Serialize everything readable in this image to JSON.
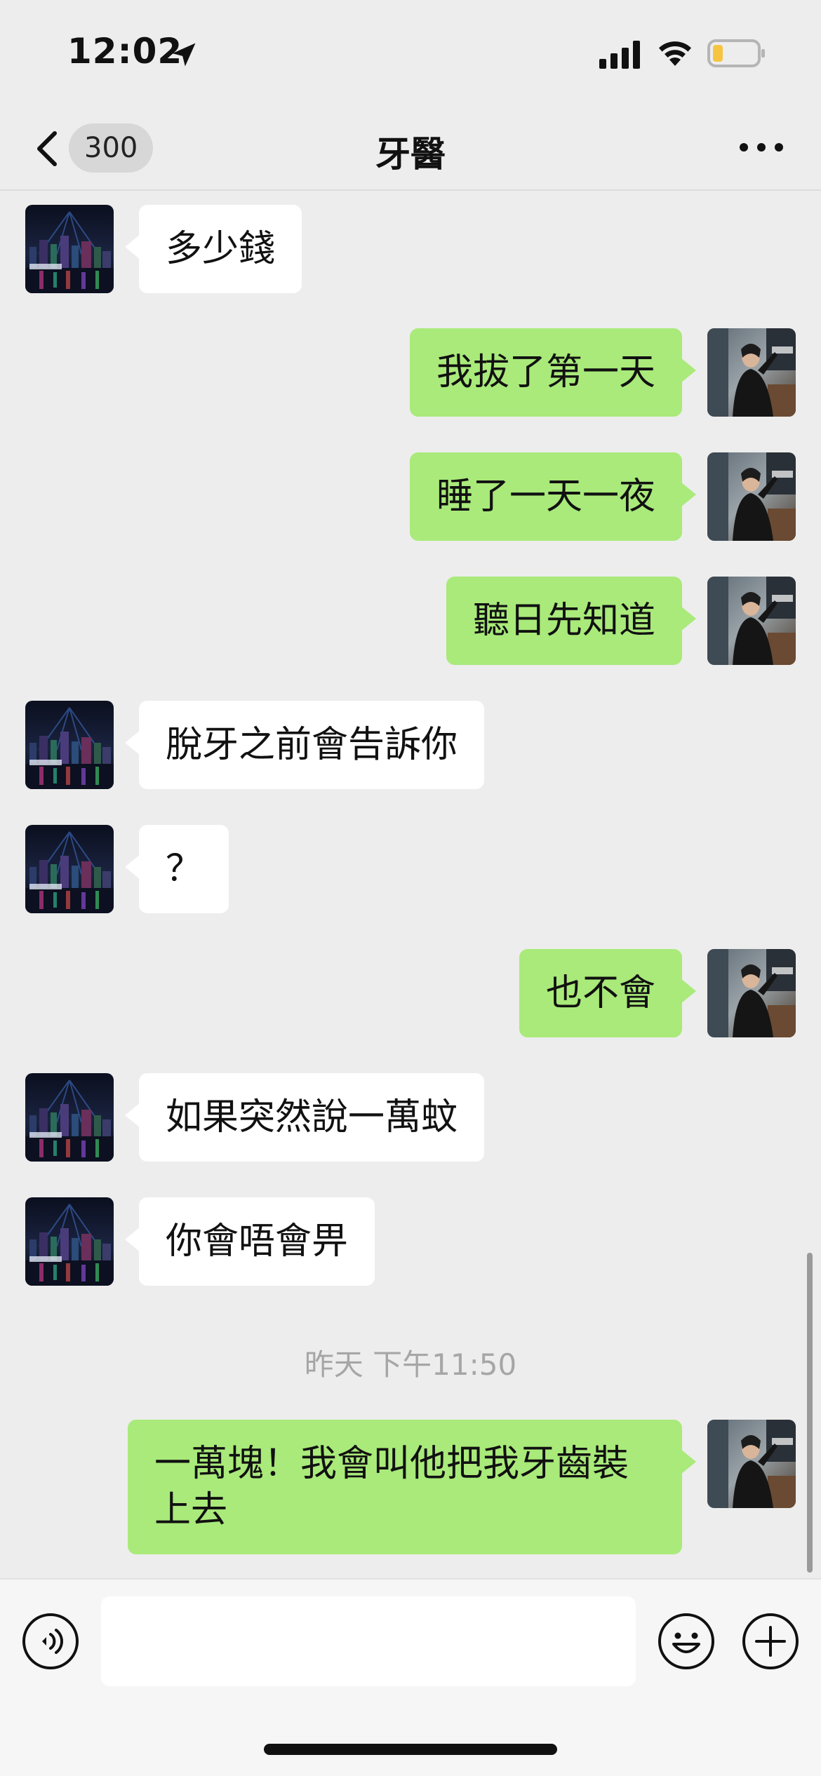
{
  "status_bar": {
    "time": "12:02",
    "icons": [
      "location-arrow-icon",
      "signal-icon",
      "wifi-icon",
      "battery-low-icon"
    ]
  },
  "nav": {
    "unread_count": "300",
    "title": "牙醫",
    "icons": [
      "chevron-left-icon",
      "more-icon"
    ]
  },
  "messages": [
    {
      "side": "incoming",
      "text": "多少錢"
    },
    {
      "side": "outgoing",
      "text": "我拔了第一天"
    },
    {
      "side": "outgoing",
      "text": "睡了一天一夜"
    },
    {
      "side": "outgoing",
      "text": "聽日先知道"
    },
    {
      "side": "incoming",
      "text": "脫牙之前會告訴你"
    },
    {
      "side": "incoming",
      "text": "？"
    },
    {
      "side": "outgoing",
      "text": "也不會"
    },
    {
      "side": "incoming",
      "text": "如果突然說一萬蚊"
    },
    {
      "side": "incoming",
      "text": "你會唔會畀"
    },
    {
      "side": "outgoing",
      "text": "一萬塊！我會叫他把我牙齒裝上去"
    }
  ],
  "timestamp": "昨天 下午11:50",
  "input": {
    "value": "",
    "icons": [
      "voice-icon",
      "emoji-icon",
      "plus-icon"
    ]
  },
  "colors": {
    "background": "#ededed",
    "outgoing_bubble": "#a9ea7a",
    "incoming_bubble": "#ffffff",
    "badge": "#d7d7d7",
    "battery_level": "#f5c542"
  }
}
